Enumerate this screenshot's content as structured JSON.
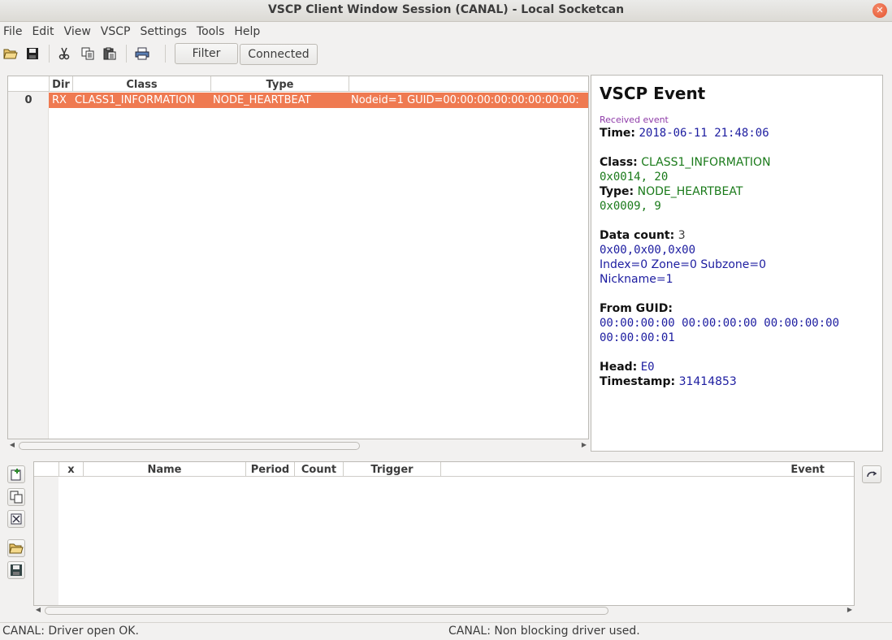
{
  "window": {
    "title": "VSCP Client Window Session (CANAL) - Local Socketcan"
  },
  "menu": [
    "File",
    "Edit",
    "View",
    "VSCP",
    "Settings",
    "Tools",
    "Help"
  ],
  "toolbar": {
    "icons": [
      "open-folder-icon",
      "save-icon",
      "cut-icon",
      "copy-icon",
      "paste-icon",
      "print-icon"
    ],
    "filter_label": "Filter",
    "connected_label": "Connected"
  },
  "event_list": {
    "columns": [
      "",
      "Dir",
      "Class",
      "Type",
      ""
    ],
    "rows": [
      {
        "num": "0",
        "dir": "RX",
        "class": "CLASS1_INFORMATION",
        "type": "NODE_HEARTBEAT",
        "note": "Nodeid=1 GUID=00:00:00:00:00:00:00:00:"
      }
    ]
  },
  "detail": {
    "heading": "VSCP Event",
    "received": "Received event",
    "time_label": "Time:",
    "time_value": "2018-06-11 21:48:06",
    "class_label": "Class:",
    "class_value": "CLASS1_INFORMATION",
    "class_code": "0x0014, 20",
    "type_label": "Type:",
    "type_value": "NODE_HEARTBEAT",
    "type_code": "0x0009, 9",
    "datacount_label": "Data count:",
    "datacount_value": "3",
    "data_bytes": "0x00,0x00,0x00",
    "data_decode": "Index=0 Zone=0 Subzone=0",
    "nickname": "Nickname=1",
    "guid_label": "From GUID:",
    "guid_line1": "00:00:00:00 00:00:00:00 00:00:00:00",
    "guid_line2": "00:00:00:01",
    "head_label": "Head:",
    "head_value": "E0",
    "timestamp_label": "Timestamp:",
    "timestamp_value": "31414853"
  },
  "tx_list": {
    "columns": [
      "",
      "x",
      "Name",
      "Period",
      "Count",
      "Trigger",
      "Event"
    ]
  },
  "status": {
    "left": "CANAL: Driver open OK.",
    "right": "CANAL: Non blocking driver used."
  }
}
